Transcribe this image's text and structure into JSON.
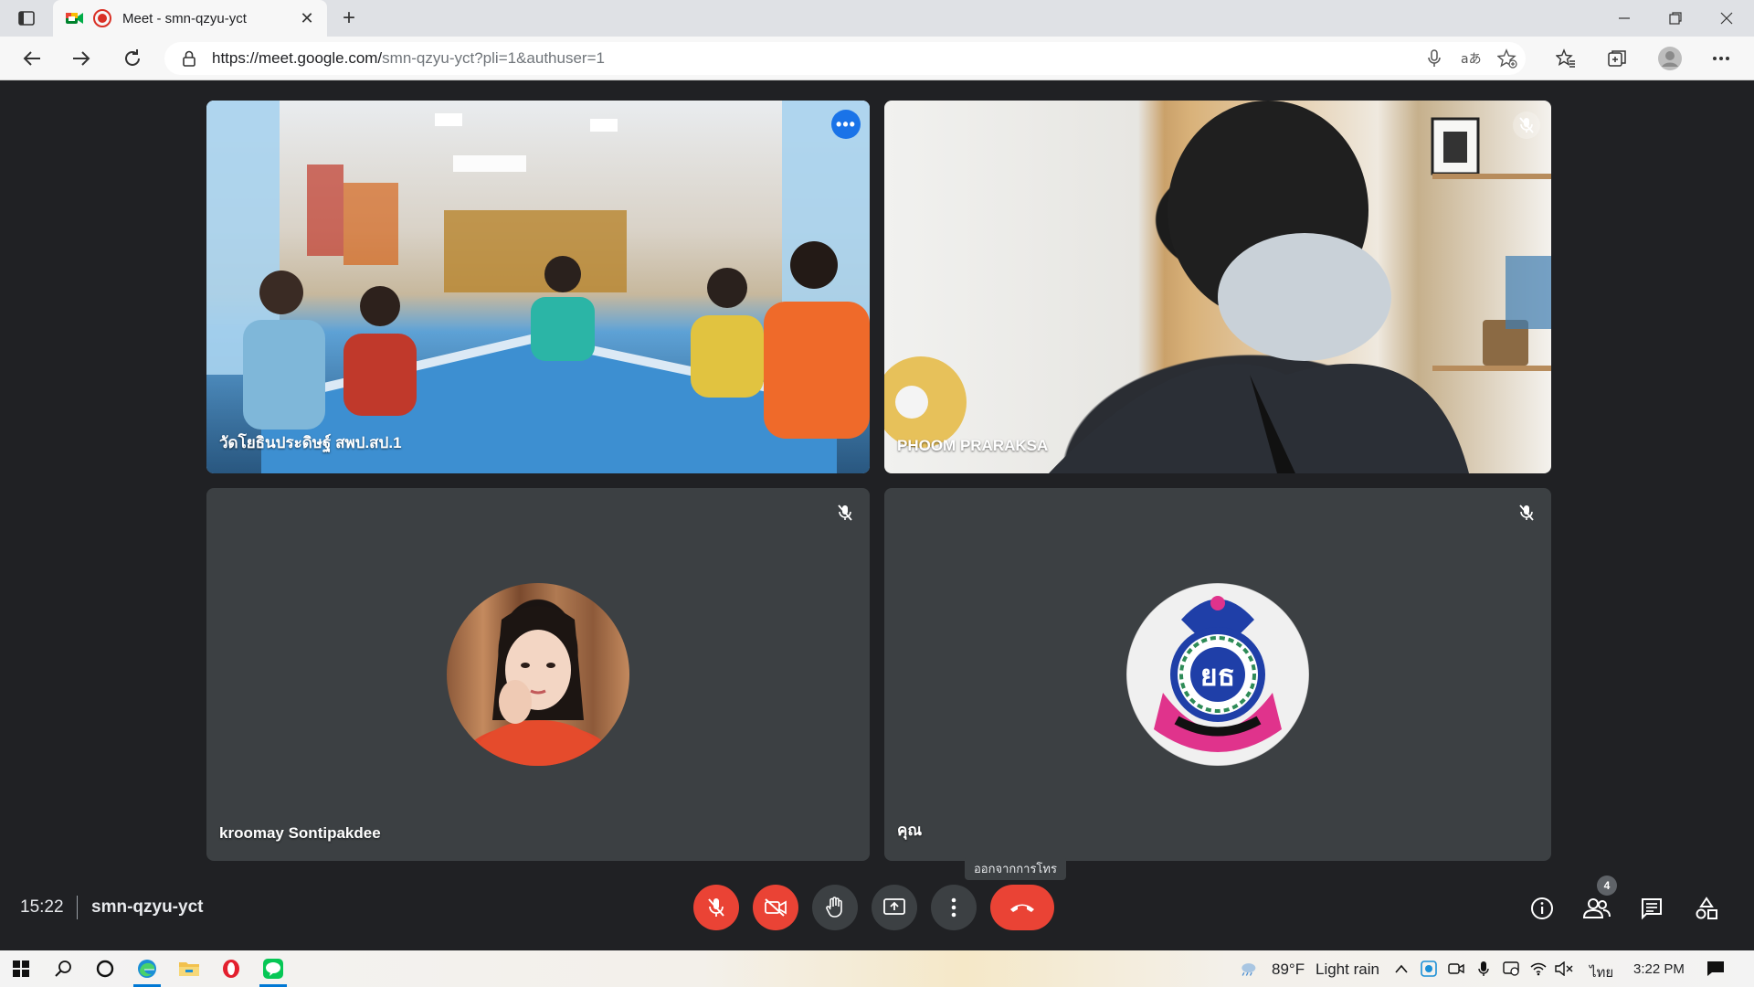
{
  "browser": {
    "tab_title": "Meet - smn-qzyu-yct",
    "tab_close": "✕",
    "new_tab": "+",
    "url_host": "https://meet.google.com/",
    "url_path": "smn-qzyu-yct?pli=1&authuser=1"
  },
  "meet": {
    "participants": [
      {
        "name": "วัดโยธินประดิษฐ์ สพป.สป.1",
        "muted": false,
        "active": true
      },
      {
        "name": "PHOOM PRARAKSA",
        "muted": true,
        "active": false
      },
      {
        "name": "kroomay Sontipakdee",
        "muted": true,
        "active": false
      },
      {
        "name": "คุณ",
        "muted": true,
        "active": false
      }
    ],
    "tooltip_leave": "ออกจากการโทร",
    "time": "15:22",
    "meeting_code": "smn-qzyu-yct",
    "people_count": "4"
  },
  "taskbar": {
    "weather": "89°F",
    "weather_desc": "Light rain",
    "lang": "ไทย",
    "clock": "3:22 PM"
  }
}
